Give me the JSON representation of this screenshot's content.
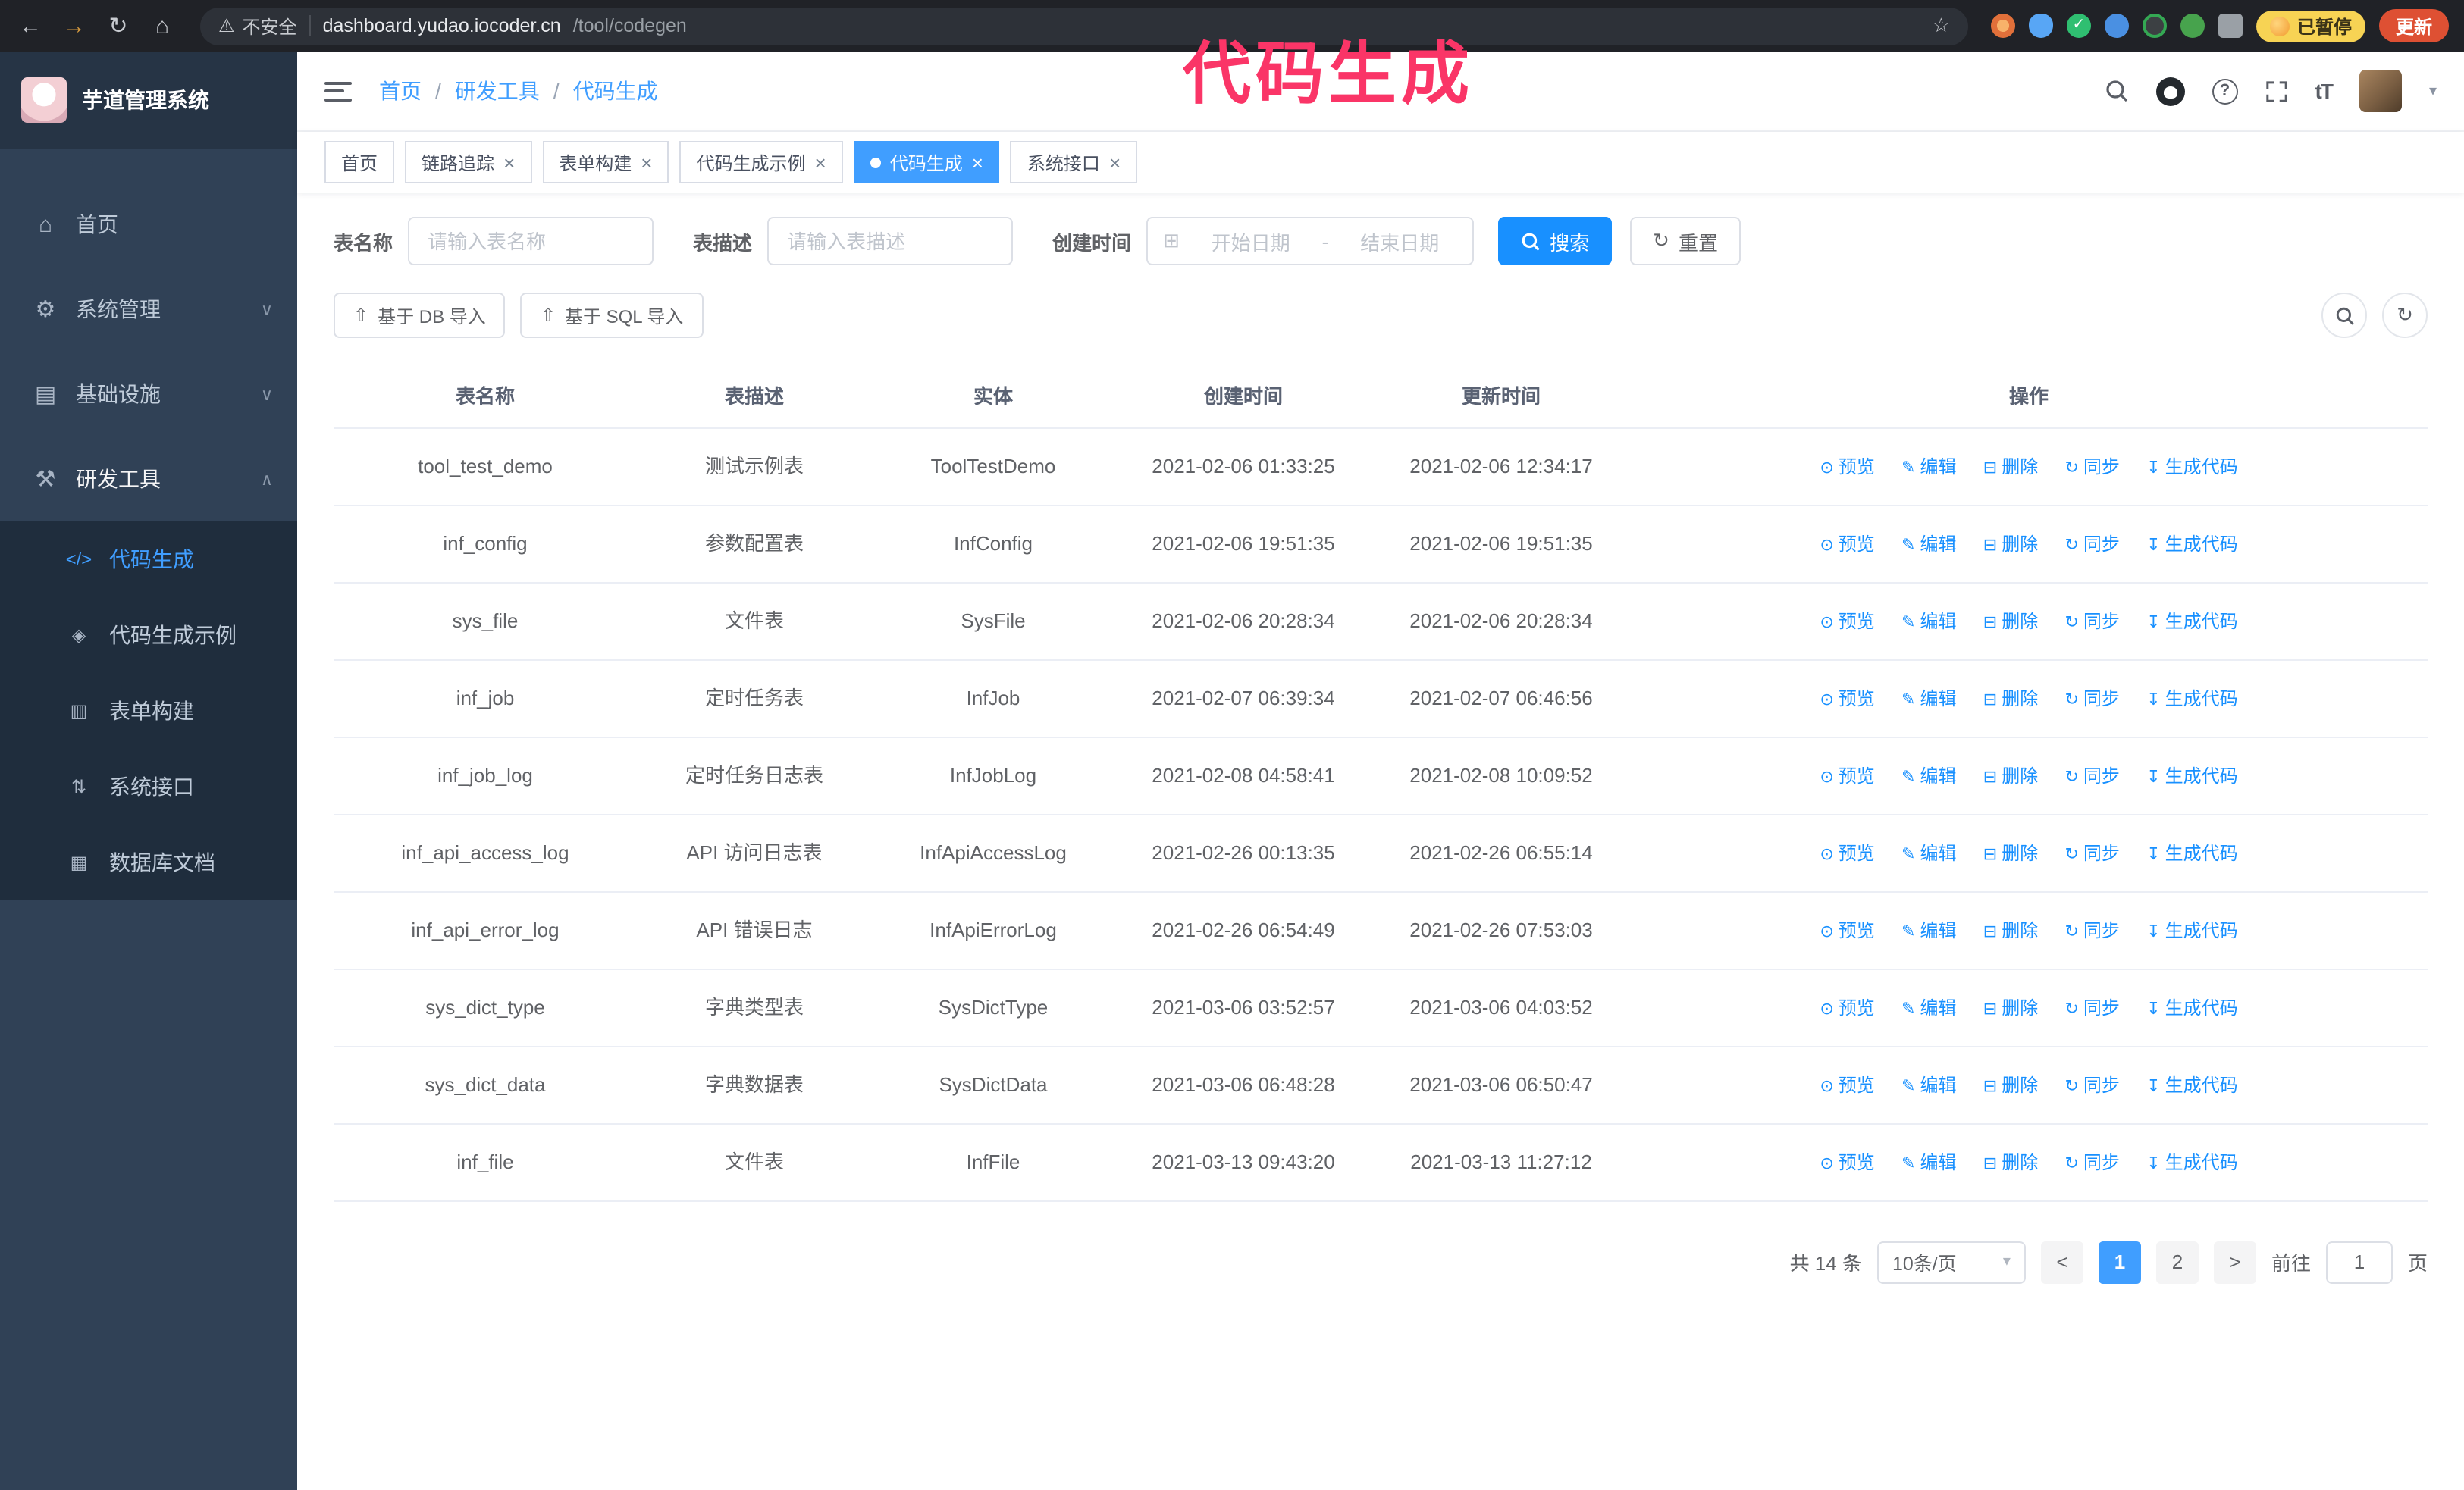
{
  "colors": {
    "primary": "#409eff",
    "link": "#1890ff",
    "annotation": "#fa3567",
    "sidebar_bg": "#304156",
    "submenu_bg": "#1f2d3d",
    "update_button": "#de5033",
    "paused_badge": "#f7d354"
  },
  "icons": {
    "back": "←",
    "forward": "→",
    "reload": "↻",
    "home": "⌂",
    "warning": "⚠",
    "star": "☆",
    "menu_home": "⌂",
    "menu_system": "⚙",
    "menu_infra": "▤",
    "menu_dev": "⚒",
    "sub_codegen": "</>",
    "sub_example": "◈",
    "sub_form": "▥",
    "sub_api": "⇅",
    "sub_db": "▦",
    "chevron_down": "∨",
    "chevron_up": "∧",
    "caret_down": "▾",
    "close": "×",
    "help": "?",
    "font_size": "tT",
    "upload": "⇧",
    "calendar": "⊞",
    "refresh": "↻",
    "preview": "⊙",
    "edit": "✎",
    "delete": "⊟",
    "sync": "↻",
    "generate": "↧",
    "prev": "<",
    "next": ">"
  },
  "browser": {
    "security_label": "不安全",
    "url_host": "dashboard.yudao.iocoder.cn",
    "url_path": "/tool/codegen",
    "paused_badge": "已暂停",
    "update_button": "更新"
  },
  "annotation": "代码生成",
  "sidebar": {
    "title": "芋道管理系统",
    "items": [
      {
        "label": "首页"
      },
      {
        "label": "系统管理"
      },
      {
        "label": "基础设施"
      },
      {
        "label": "研发工具"
      }
    ],
    "submenu": [
      {
        "label": "代码生成"
      },
      {
        "label": "代码生成示例"
      },
      {
        "label": "表单构建"
      },
      {
        "label": "系统接口"
      },
      {
        "label": "数据库文档"
      }
    ]
  },
  "header": {
    "separator": "/",
    "breadcrumb": [
      "首页",
      "研发工具",
      "代码生成"
    ]
  },
  "tabs": [
    {
      "label": "首页"
    },
    {
      "label": "链路追踪"
    },
    {
      "label": "表单构建"
    },
    {
      "label": "代码生成示例"
    },
    {
      "label": "代码生成"
    },
    {
      "label": "系统接口"
    }
  ],
  "filters": {
    "table_name_label": "表名称",
    "table_name_placeholder": "请输入表名称",
    "table_desc_label": "表描述",
    "table_desc_placeholder": "请输入表描述",
    "create_time_label": "创建时间",
    "date_start_placeholder": "开始日期",
    "date_separator": "-",
    "date_end_placeholder": "结束日期",
    "search_button": "搜索",
    "reset_button": "重置"
  },
  "toolbar": {
    "import_db": "基于 DB 导入",
    "import_sql": "基于 SQL 导入"
  },
  "table": {
    "columns": [
      "表名称",
      "表描述",
      "实体",
      "创建时间",
      "更新时间",
      "操作"
    ],
    "actions": [
      "预览",
      "编辑",
      "删除",
      "同步",
      "生成代码"
    ],
    "rows": [
      {
        "name": "tool_test_demo",
        "desc": "测试示例表",
        "entity": "ToolTestDemo",
        "created": "2021-02-06 01:33:25",
        "updated": "2021-02-06 12:34:17"
      },
      {
        "name": "inf_config",
        "desc": "参数配置表",
        "entity": "InfConfig",
        "created": "2021-02-06 19:51:35",
        "updated": "2021-02-06 19:51:35"
      },
      {
        "name": "sys_file",
        "desc": "文件表",
        "entity": "SysFile",
        "created": "2021-02-06 20:28:34",
        "updated": "2021-02-06 20:28:34"
      },
      {
        "name": "inf_job",
        "desc": "定时任务表",
        "entity": "InfJob",
        "created": "2021-02-07 06:39:34",
        "updated": "2021-02-07 06:46:56"
      },
      {
        "name": "inf_job_log",
        "desc": "定时任务日志表",
        "entity": "InfJobLog",
        "created": "2021-02-08 04:58:41",
        "updated": "2021-02-08 10:09:52"
      },
      {
        "name": "inf_api_access_log",
        "desc": "API 访问日志表",
        "entity": "InfApiAccessLog",
        "created": "2021-02-26 00:13:35",
        "updated": "2021-02-26 06:55:14"
      },
      {
        "name": "inf_api_error_log",
        "desc": "API 错误日志",
        "entity": "InfApiErrorLog",
        "created": "2021-02-26 06:54:49",
        "updated": "2021-02-26 07:53:03"
      },
      {
        "name": "sys_dict_type",
        "desc": "字典类型表",
        "entity": "SysDictType",
        "created": "2021-03-06 03:52:57",
        "updated": "2021-03-06 04:03:52"
      },
      {
        "name": "sys_dict_data",
        "desc": "字典数据表",
        "entity": "SysDictData",
        "created": "2021-03-06 06:48:28",
        "updated": "2021-03-06 06:50:47"
      },
      {
        "name": "inf_file",
        "desc": "文件表",
        "entity": "InfFile",
        "created": "2021-03-13 09:43:20",
        "updated": "2021-03-13 11:27:12"
      }
    ]
  },
  "pagination": {
    "total": "共 14 条",
    "page_size": "10条/页",
    "page1": "1",
    "page2": "2",
    "goto_label": "前往",
    "goto_value": "1",
    "goto_suffix": "页"
  }
}
